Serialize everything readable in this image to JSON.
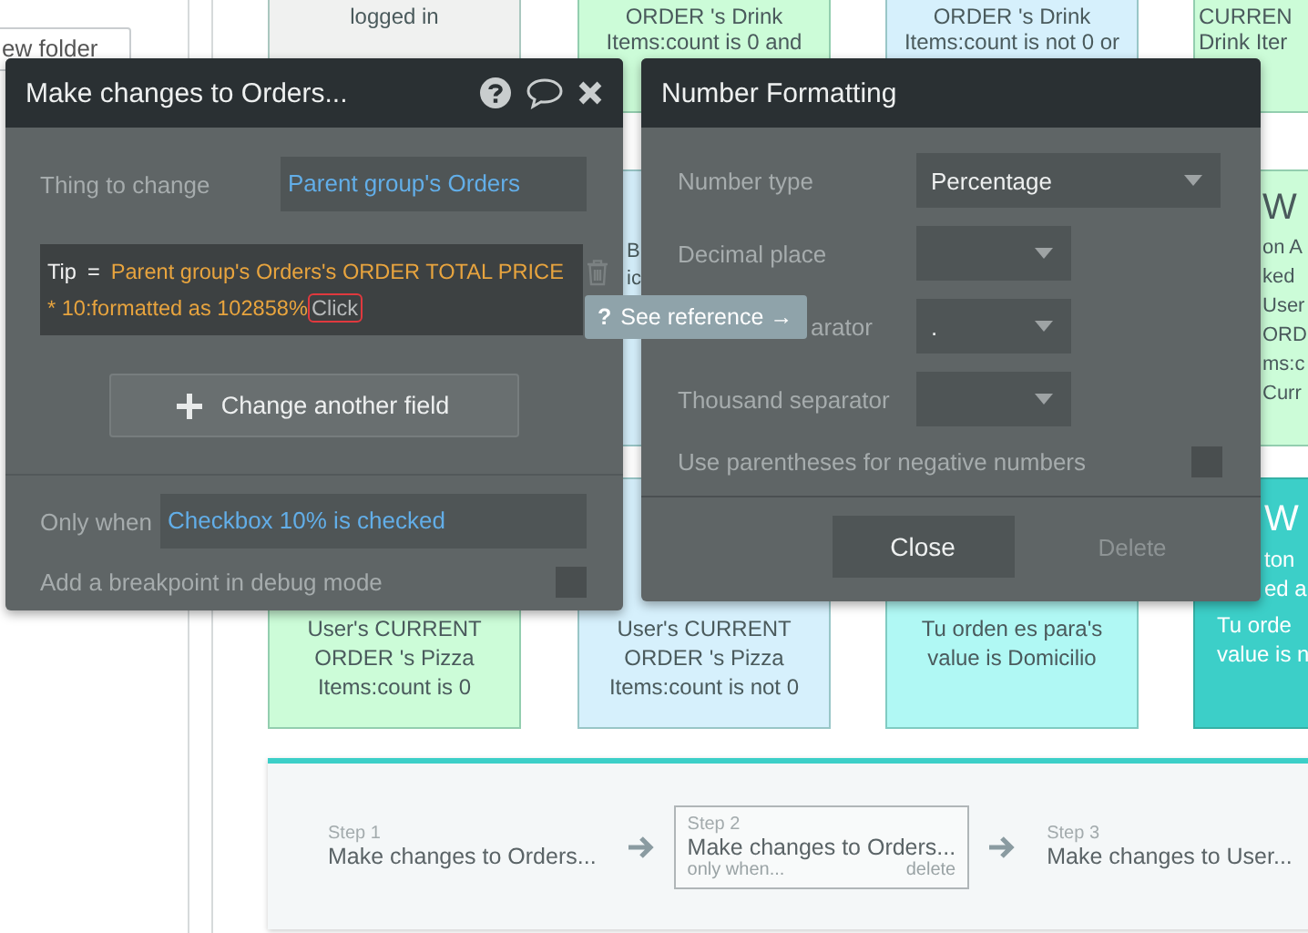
{
  "sidebar": {
    "folder_field": "ew folder"
  },
  "canvas_rows": [
    [
      {
        "color": "#f0f1f0",
        "lines": [
          "logged in"
        ]
      },
      {
        "color": "#ccfcd8",
        "lines": [
          "ORDER 's Drink",
          "Items:count is 0 and"
        ]
      },
      {
        "color": "#d6f0fc",
        "lines": [
          "ORDER 's Drink",
          "Items:count is not 0 or"
        ]
      },
      {
        "color": "#ccfcd8",
        "lines": [
          "CURREN",
          "Drink Iter"
        ]
      }
    ],
    [
      {
        "color": "#d6f0fc",
        "lines": [
          "B",
          "ic"
        ]
      },
      {
        "color": "#ccfcd8",
        "heading": "W",
        "lines": [
          "on A",
          "ked",
          "User",
          "ORD",
          "ms:c",
          "Curr"
        ]
      }
    ],
    [
      {
        "color": "#ccfcd8",
        "lines": [
          "User's CURRENT",
          "ORDER 's Pizza",
          "Items:count is 0"
        ]
      },
      {
        "color": "#d6f0fc",
        "lines": [
          "User's CURRENT",
          "ORDER 's Pizza",
          "Items:count is not 0"
        ]
      },
      {
        "color": "#b0f8f4",
        "lines": [
          "Tu orden es para's",
          "value is Domicilio"
        ]
      },
      {
        "color": "#3ccfc8",
        "heading": "W",
        "lines": [
          "ton",
          "ed a",
          "Tu orde",
          "value is n"
        ]
      }
    ]
  ],
  "workflow": {
    "steps": [
      {
        "label": "Step 1",
        "title": "Make changes to Orders...",
        "selected": false
      },
      {
        "label": "Step 2",
        "title": "Make changes to Orders...",
        "selected": true,
        "condition": "only when...",
        "delete": "delete"
      },
      {
        "label": "Step 3",
        "title": "Make changes to User...",
        "selected": false
      }
    ]
  },
  "action_dialog": {
    "title": "Make changes to Orders...",
    "thing_label": "Thing to change",
    "thing_value": "Parent group's Orders",
    "expression": {
      "field": "Tip",
      "operator": "=",
      "value_lines": [
        "Parent group's Orders's ORDER TOTAL PRICE",
        "* 10:formatted as 102858%"
      ],
      "hint": "Click"
    },
    "add_button": "Change another field",
    "only_when_label": "Only when",
    "only_when_value": "Checkbox 10% is checked",
    "breakpoint_label": "Add a breakpoint in debug mode",
    "breakpoint_checked": false
  },
  "see_reference": {
    "icon": "?",
    "label": "See reference →"
  },
  "format_dialog": {
    "title": "Number Formatting",
    "rows": [
      {
        "kind": "select",
        "label": "Number type",
        "value": "Percentage"
      },
      {
        "kind": "select",
        "label": "Decimal place"
      },
      {
        "kind": "select",
        "label": "arator",
        "value": "."
      },
      {
        "kind": "select",
        "label": "Thousand separator"
      },
      {
        "kind": "checkbox",
        "label": "Use parentheses for negative numbers",
        "checked": false
      }
    ],
    "buttons": [
      {
        "label": "Close",
        "disabled": false
      },
      {
        "label": "Delete",
        "disabled": true
      }
    ]
  }
}
